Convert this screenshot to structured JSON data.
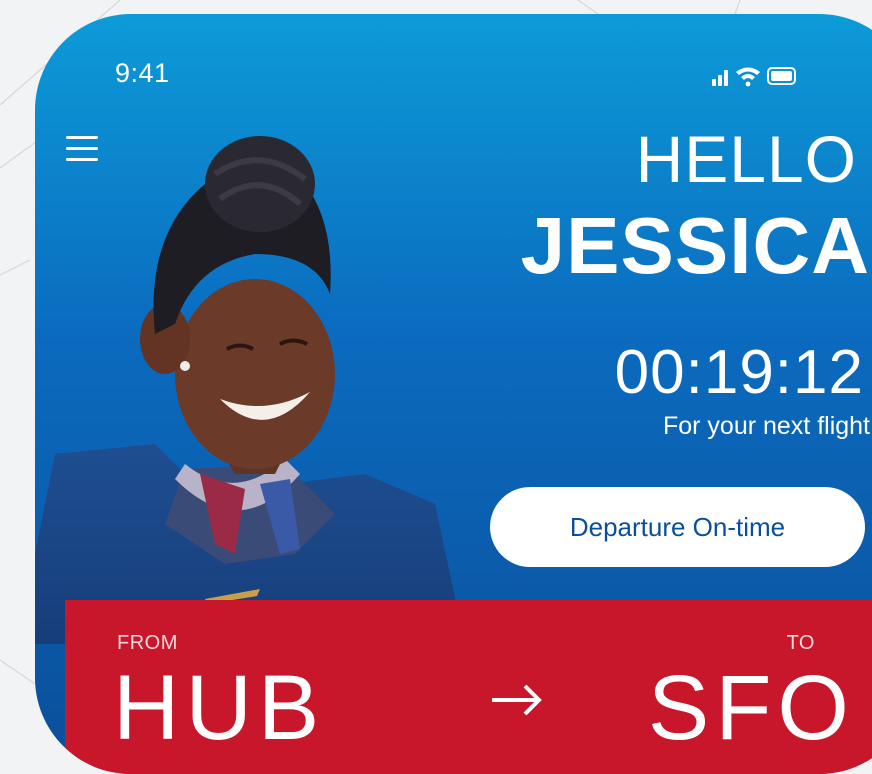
{
  "status_bar": {
    "time": "9:41",
    "icons": [
      "signal-icon",
      "wifi-icon",
      "battery-icon"
    ]
  },
  "menu": {
    "icon": "hamburger-menu-icon"
  },
  "greeting": {
    "hello": "HELLO",
    "name": "JESSICA"
  },
  "countdown": {
    "time": "00:19:12",
    "caption": "For your next flight"
  },
  "departure_button": {
    "label": "Departure On-time"
  },
  "route": {
    "from_label": "FROM",
    "from_code": "HUB",
    "to_label": "TO",
    "to_code": "SFO"
  },
  "colors": {
    "sky_top": "#0c9bd8",
    "sky_bottom": "#0b4e99",
    "route_red": "#c8162b",
    "button_text": "#0b4f98"
  }
}
